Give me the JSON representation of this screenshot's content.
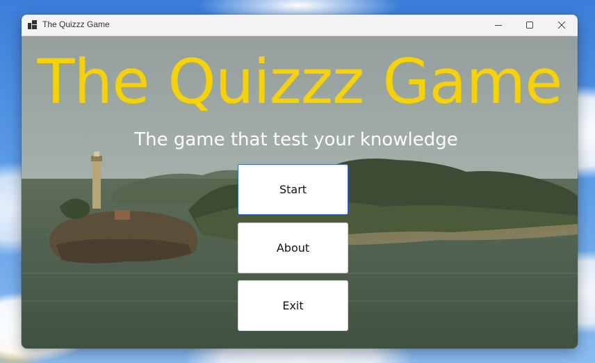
{
  "window": {
    "title": "The Quizzz Game",
    "controls": {
      "minimize_icon": "minimize-icon",
      "maximize_icon": "maximize-icon",
      "close_icon": "close-icon"
    }
  },
  "main": {
    "title": "The Quizzz Game",
    "subtitle": "The game that test your knowledge",
    "title_color": "#f5d200",
    "buttons": {
      "start": "Start",
      "about": "About",
      "exit": "Exit"
    }
  }
}
